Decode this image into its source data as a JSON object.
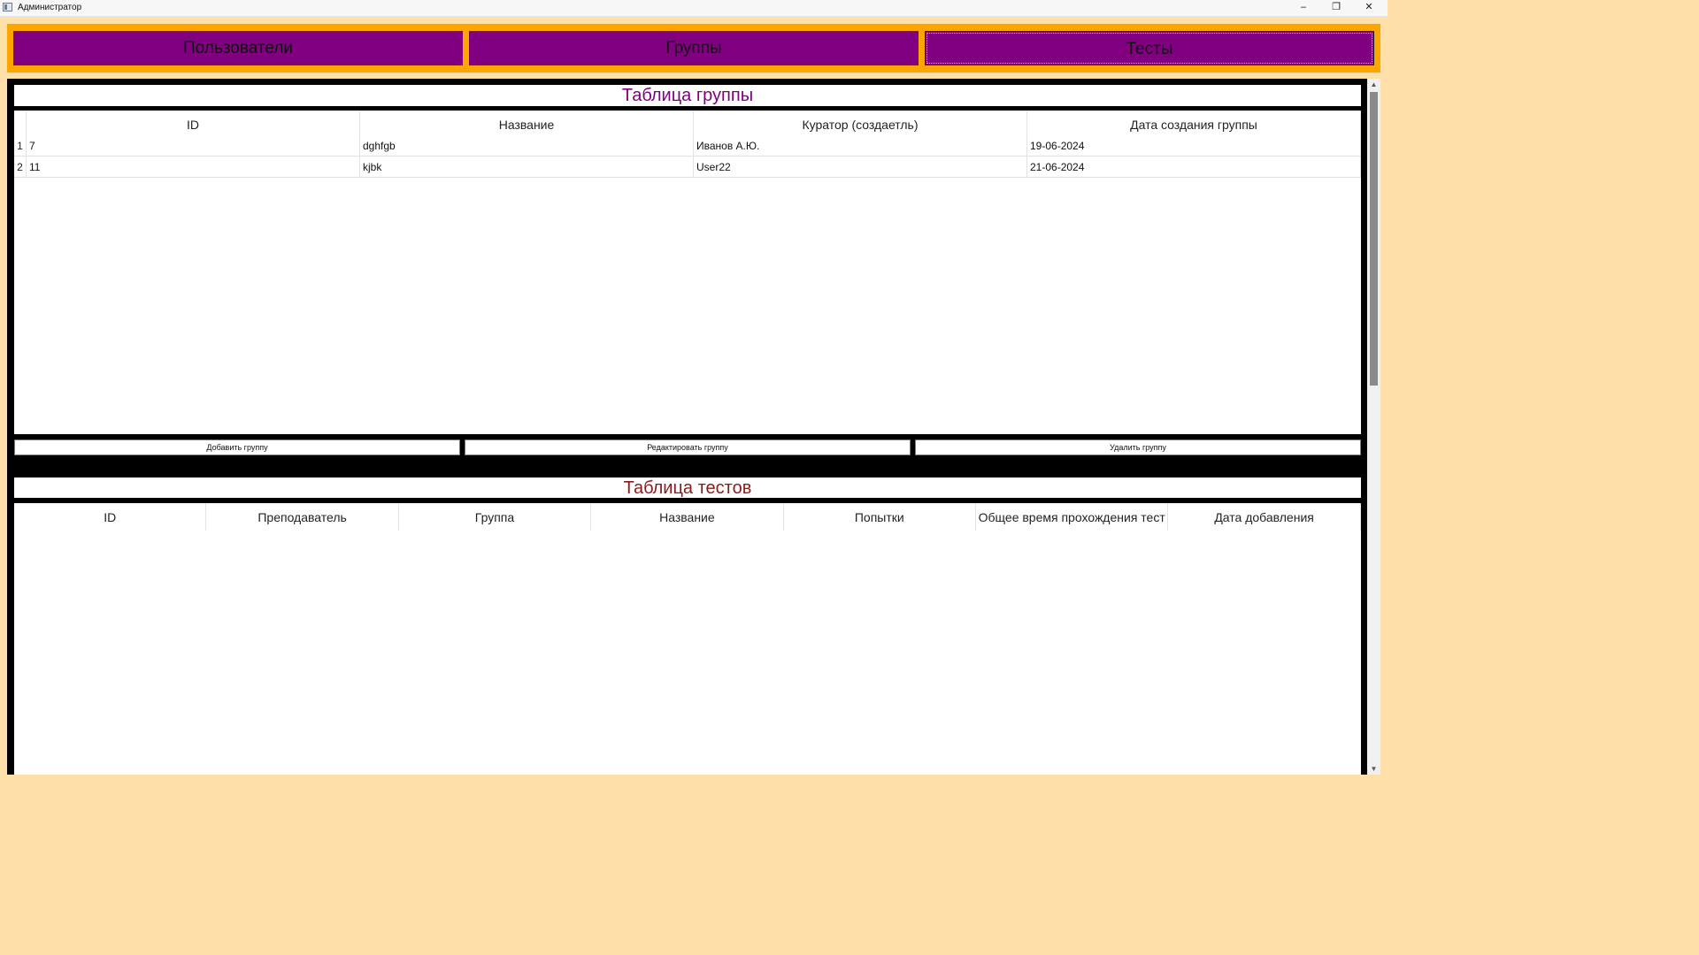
{
  "window": {
    "title": "Администратор",
    "minimize": "–",
    "restore": "❐",
    "close": "✕"
  },
  "nav": {
    "users": "Пользователи",
    "groups": "Группы",
    "tests": "Тесты"
  },
  "groups_table": {
    "title": "Таблица группы",
    "columns": [
      "ID",
      "Название",
      "Куратор (создаетль)",
      "Дата создания группы"
    ],
    "rows": [
      {
        "num": "1",
        "id": "7",
        "name": "dghfgb",
        "curator": "Иванов А.Ю.",
        "date": "19-06-2024"
      },
      {
        "num": "2",
        "id": "11",
        "name": "kjbk",
        "curator": "User22",
        "date": "21-06-2024"
      }
    ]
  },
  "actions": {
    "add": "Добавить группу",
    "edit": "Редактировать группу",
    "delete": "Удалить группу"
  },
  "tests_table": {
    "title": "Таблица тестов",
    "columns": [
      "ID",
      "Преподаватель",
      "Группа",
      "Название",
      "Попытки",
      "Общее время прохождения тест",
      "Дата добавления"
    ]
  },
  "colors": {
    "nav_bg": "#ffa500",
    "nav_button": "#800080",
    "groups_title": "#800080",
    "tests_title": "#8b1a1a",
    "window_bg": "#ffe0a8"
  }
}
